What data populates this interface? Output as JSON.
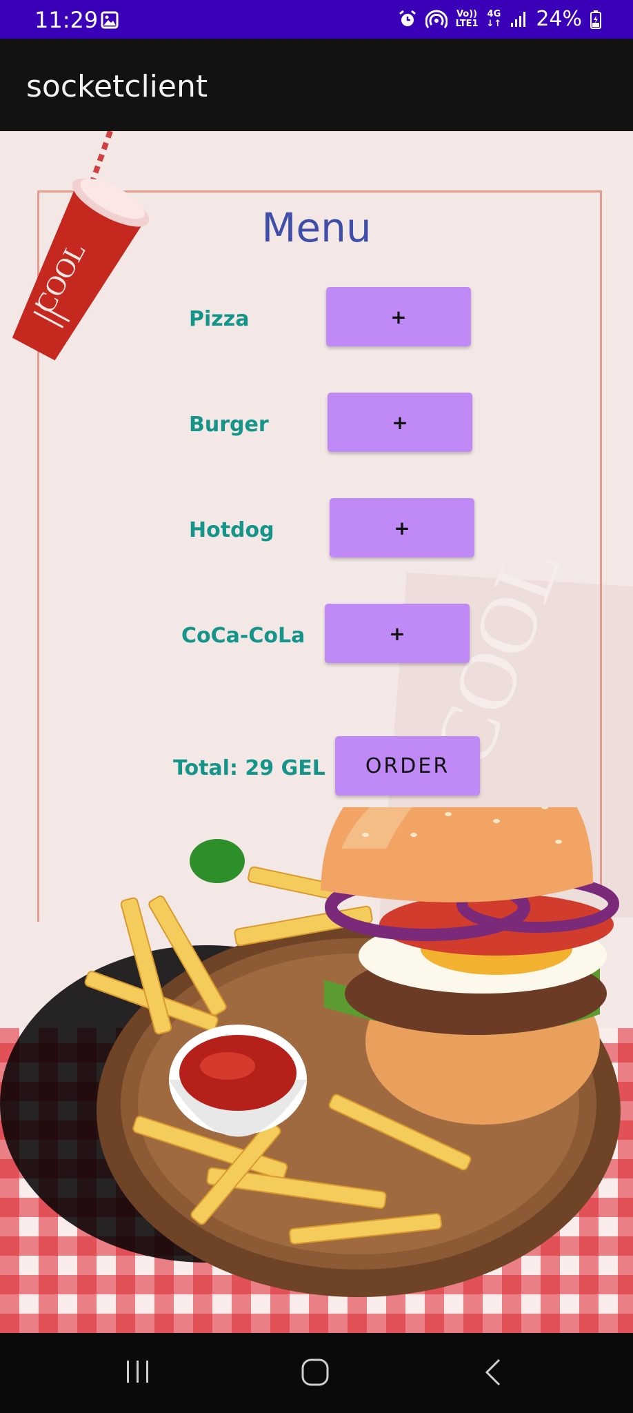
{
  "status_bar": {
    "time": "11:29",
    "network_top": "Vo))",
    "network_bottom": "LTE1",
    "gen": "4G",
    "battery": "24%"
  },
  "app_bar": {
    "title": "socketclient"
  },
  "menu": {
    "title": "Menu",
    "items": [
      {
        "label": "Pizza",
        "button": "+"
      },
      {
        "label": "Burger",
        "button": "+"
      },
      {
        "label": "Hotdog",
        "button": "+"
      },
      {
        "label": "CoCa-CoLa",
        "button": "+"
      }
    ],
    "total": "Total: 29 GEL",
    "order_button": "ORDER"
  },
  "decor": {
    "cup_text": "COOL"
  },
  "colors": {
    "status_bar": "#3a00b8",
    "app_bar": "#121212",
    "button": "#bf8af5",
    "label": "#15958a",
    "title": "#3f4ea8"
  }
}
